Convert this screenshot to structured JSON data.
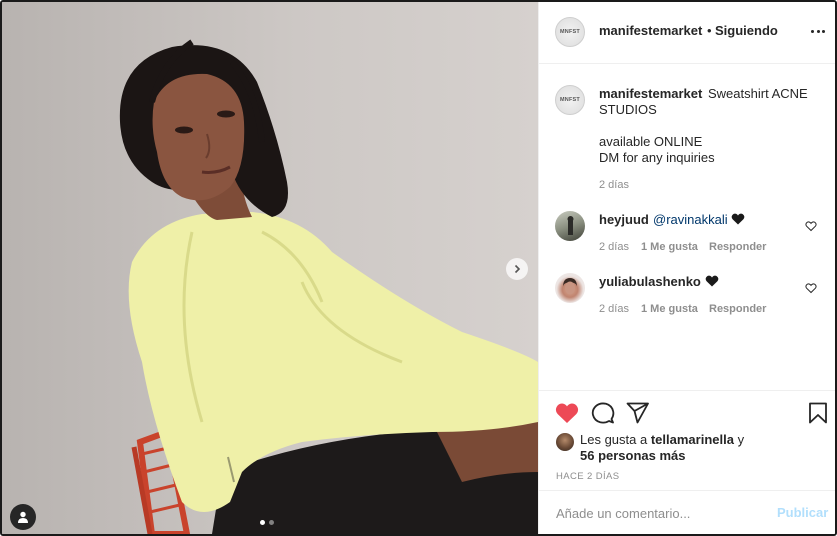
{
  "post": {
    "username": "manifestemarket",
    "separator": "•",
    "follow_status": "Siguiendo",
    "avatar_text": "MNFST",
    "caption_username": "manifestemarket",
    "caption_line1": "Sweatshirt ACNE",
    "caption_line2": "STUDIOS",
    "caption_line3": "available ONLINE",
    "caption_line4": "DM for any inquiries",
    "caption_time": "2 días"
  },
  "comments": [
    {
      "username": "heyjuud",
      "mention": "@ravinakkali",
      "emoji": "black-heart",
      "time": "2 días",
      "likes": "1 Me gusta",
      "reply": "Responder"
    },
    {
      "username": "yuliabulashenko",
      "emoji": "black-heart",
      "time": "2 días",
      "likes": "1 Me gusta",
      "reply": "Responder"
    }
  ],
  "likes": {
    "prefix": "Les gusta a",
    "user": "tellamarinella",
    "connector": "y",
    "others": "56 personas más"
  },
  "timestamp": "HACE 2 DÍAS",
  "comment_box": {
    "placeholder": "Añade un comentario...",
    "submit_label": "Publicar"
  },
  "carousel": {
    "current": 1,
    "total": 2
  },
  "colors": {
    "liked_heart": "#ed4956",
    "mention": "#00376b",
    "publish_disabled": "#b2dffc",
    "secondary_text": "#8e8e8e"
  },
  "icons": [
    "more-icon",
    "heart-icon",
    "comment-icon",
    "share-icon",
    "bookmark-icon",
    "chevron-right-icon",
    "person-tag-icon"
  ]
}
